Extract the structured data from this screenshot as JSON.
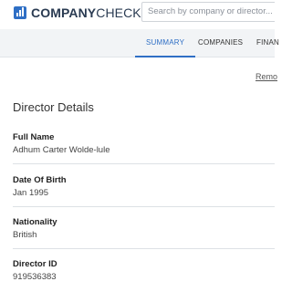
{
  "header": {
    "logo_bold": "COMPANY",
    "logo_light": "CHECK",
    "search_placeholder": "Search by company or director..."
  },
  "nav": {
    "tabs": [
      {
        "label": "SUMMARY",
        "active": true
      },
      {
        "label": "COMPANIES",
        "active": false
      },
      {
        "label": "FINAN",
        "active": false
      }
    ]
  },
  "main": {
    "remove_link": "Remo",
    "section_title": "Director Details",
    "fields": [
      {
        "label": "Full Name",
        "value": "Adhum Carter Wolde-lule"
      },
      {
        "label": "Date Of Birth",
        "value": "Jan 1995"
      },
      {
        "label": "Nationality",
        "value": "British"
      },
      {
        "label": "Director ID",
        "value": "919536383"
      }
    ]
  },
  "colors": {
    "accent": "#2f6fc5",
    "nav_background": "#f2f4f6"
  }
}
